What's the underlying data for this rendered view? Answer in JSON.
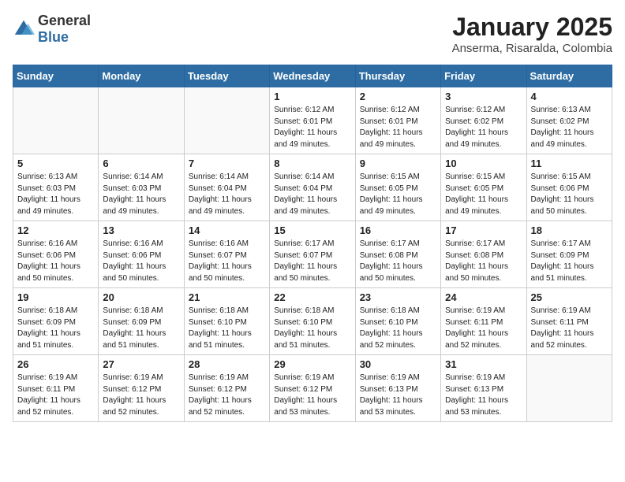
{
  "header": {
    "logo": {
      "general": "General",
      "blue": "Blue"
    },
    "title": "January 2025",
    "location": "Anserma, Risaralda, Colombia"
  },
  "weekdays": [
    "Sunday",
    "Monday",
    "Tuesday",
    "Wednesday",
    "Thursday",
    "Friday",
    "Saturday"
  ],
  "weeks": [
    [
      {
        "day": "",
        "info": ""
      },
      {
        "day": "",
        "info": ""
      },
      {
        "day": "",
        "info": ""
      },
      {
        "day": "1",
        "info": "Sunrise: 6:12 AM\nSunset: 6:01 PM\nDaylight: 11 hours and 49 minutes."
      },
      {
        "day": "2",
        "info": "Sunrise: 6:12 AM\nSunset: 6:01 PM\nDaylight: 11 hours and 49 minutes."
      },
      {
        "day": "3",
        "info": "Sunrise: 6:12 AM\nSunset: 6:02 PM\nDaylight: 11 hours and 49 minutes."
      },
      {
        "day": "4",
        "info": "Sunrise: 6:13 AM\nSunset: 6:02 PM\nDaylight: 11 hours and 49 minutes."
      }
    ],
    [
      {
        "day": "5",
        "info": "Sunrise: 6:13 AM\nSunset: 6:03 PM\nDaylight: 11 hours and 49 minutes."
      },
      {
        "day": "6",
        "info": "Sunrise: 6:14 AM\nSunset: 6:03 PM\nDaylight: 11 hours and 49 minutes."
      },
      {
        "day": "7",
        "info": "Sunrise: 6:14 AM\nSunset: 6:04 PM\nDaylight: 11 hours and 49 minutes."
      },
      {
        "day": "8",
        "info": "Sunrise: 6:14 AM\nSunset: 6:04 PM\nDaylight: 11 hours and 49 minutes."
      },
      {
        "day": "9",
        "info": "Sunrise: 6:15 AM\nSunset: 6:05 PM\nDaylight: 11 hours and 49 minutes."
      },
      {
        "day": "10",
        "info": "Sunrise: 6:15 AM\nSunset: 6:05 PM\nDaylight: 11 hours and 49 minutes."
      },
      {
        "day": "11",
        "info": "Sunrise: 6:15 AM\nSunset: 6:06 PM\nDaylight: 11 hours and 50 minutes."
      }
    ],
    [
      {
        "day": "12",
        "info": "Sunrise: 6:16 AM\nSunset: 6:06 PM\nDaylight: 11 hours and 50 minutes."
      },
      {
        "day": "13",
        "info": "Sunrise: 6:16 AM\nSunset: 6:06 PM\nDaylight: 11 hours and 50 minutes."
      },
      {
        "day": "14",
        "info": "Sunrise: 6:16 AM\nSunset: 6:07 PM\nDaylight: 11 hours and 50 minutes."
      },
      {
        "day": "15",
        "info": "Sunrise: 6:17 AM\nSunset: 6:07 PM\nDaylight: 11 hours and 50 minutes."
      },
      {
        "day": "16",
        "info": "Sunrise: 6:17 AM\nSunset: 6:08 PM\nDaylight: 11 hours and 50 minutes."
      },
      {
        "day": "17",
        "info": "Sunrise: 6:17 AM\nSunset: 6:08 PM\nDaylight: 11 hours and 50 minutes."
      },
      {
        "day": "18",
        "info": "Sunrise: 6:17 AM\nSunset: 6:09 PM\nDaylight: 11 hours and 51 minutes."
      }
    ],
    [
      {
        "day": "19",
        "info": "Sunrise: 6:18 AM\nSunset: 6:09 PM\nDaylight: 11 hours and 51 minutes."
      },
      {
        "day": "20",
        "info": "Sunrise: 6:18 AM\nSunset: 6:09 PM\nDaylight: 11 hours and 51 minutes."
      },
      {
        "day": "21",
        "info": "Sunrise: 6:18 AM\nSunset: 6:10 PM\nDaylight: 11 hours and 51 minutes."
      },
      {
        "day": "22",
        "info": "Sunrise: 6:18 AM\nSunset: 6:10 PM\nDaylight: 11 hours and 51 minutes."
      },
      {
        "day": "23",
        "info": "Sunrise: 6:18 AM\nSunset: 6:10 PM\nDaylight: 11 hours and 52 minutes."
      },
      {
        "day": "24",
        "info": "Sunrise: 6:19 AM\nSunset: 6:11 PM\nDaylight: 11 hours and 52 minutes."
      },
      {
        "day": "25",
        "info": "Sunrise: 6:19 AM\nSunset: 6:11 PM\nDaylight: 11 hours and 52 minutes."
      }
    ],
    [
      {
        "day": "26",
        "info": "Sunrise: 6:19 AM\nSunset: 6:11 PM\nDaylight: 11 hours and 52 minutes."
      },
      {
        "day": "27",
        "info": "Sunrise: 6:19 AM\nSunset: 6:12 PM\nDaylight: 11 hours and 52 minutes."
      },
      {
        "day": "28",
        "info": "Sunrise: 6:19 AM\nSunset: 6:12 PM\nDaylight: 11 hours and 52 minutes."
      },
      {
        "day": "29",
        "info": "Sunrise: 6:19 AM\nSunset: 6:12 PM\nDaylight: 11 hours and 53 minutes."
      },
      {
        "day": "30",
        "info": "Sunrise: 6:19 AM\nSunset: 6:13 PM\nDaylight: 11 hours and 53 minutes."
      },
      {
        "day": "31",
        "info": "Sunrise: 6:19 AM\nSunset: 6:13 PM\nDaylight: 11 hours and 53 minutes."
      },
      {
        "day": "",
        "info": ""
      }
    ]
  ]
}
